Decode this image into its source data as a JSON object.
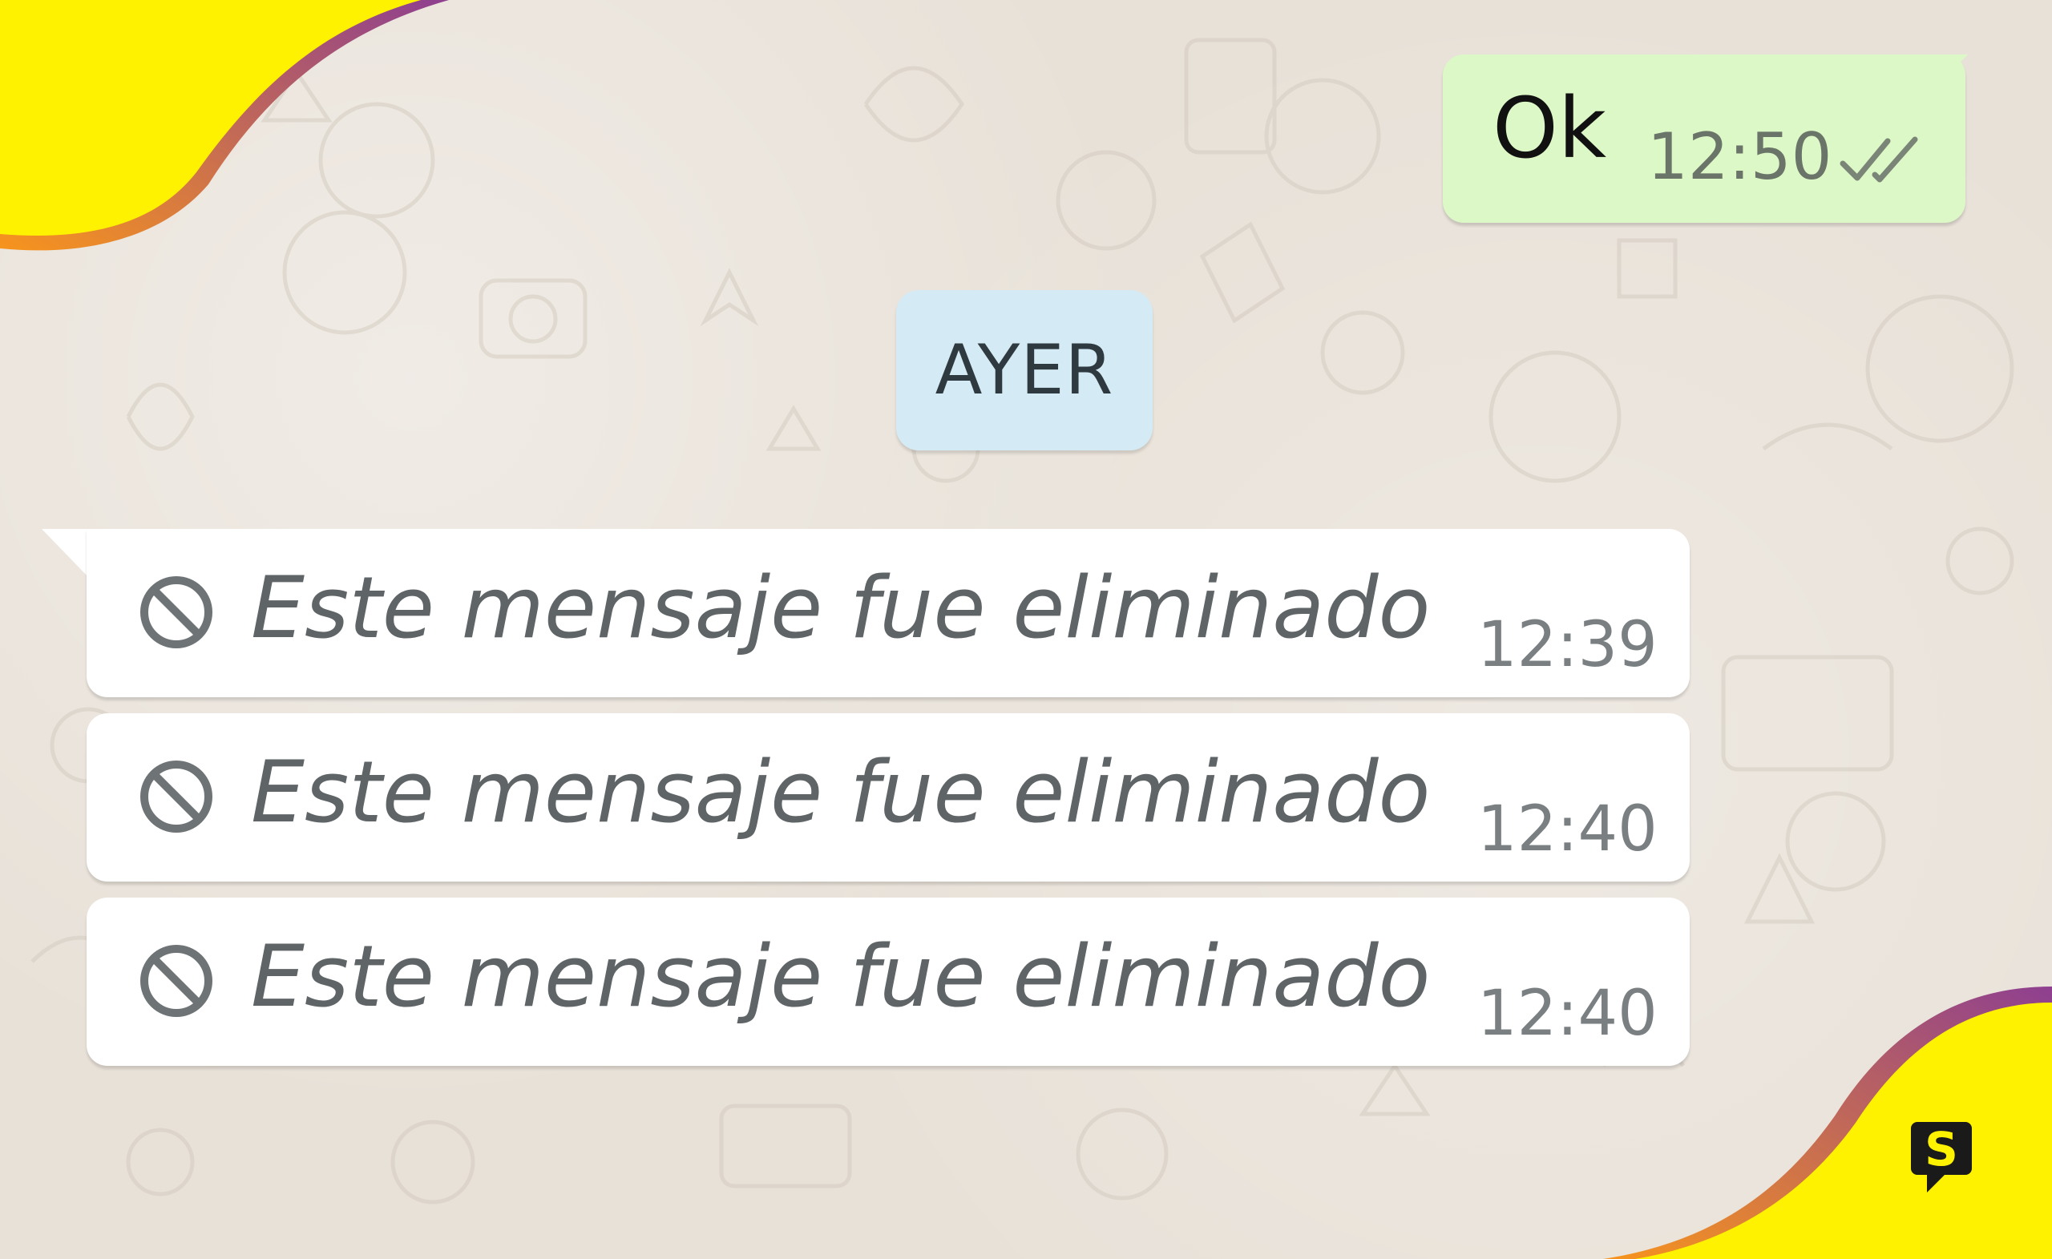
{
  "chat": {
    "outgoing": {
      "text": "Ok",
      "time": "12:50",
      "status_icon": "double-check-icon"
    },
    "date_separator": "AYER",
    "deleted_messages": [
      {
        "text": "Este mensaje fue eliminado",
        "time": "12:39",
        "icon": "block-icon"
      },
      {
        "text": "Este mensaje fue eliminado",
        "time": "12:40",
        "icon": "block-icon"
      },
      {
        "text": "Este mensaje fue eliminado",
        "time": "12:40",
        "icon": "block-icon"
      }
    ]
  },
  "brand": {
    "logo_letter": "S",
    "colors": {
      "yellow": "#fff200",
      "magenta": "#9c3f86",
      "orange": "#f7941d",
      "outgoing_bubble": "#dcf8c6",
      "incoming_bubble": "#ffffff",
      "date_pill": "#d4eaf4",
      "background": "#e8e1d8"
    }
  }
}
